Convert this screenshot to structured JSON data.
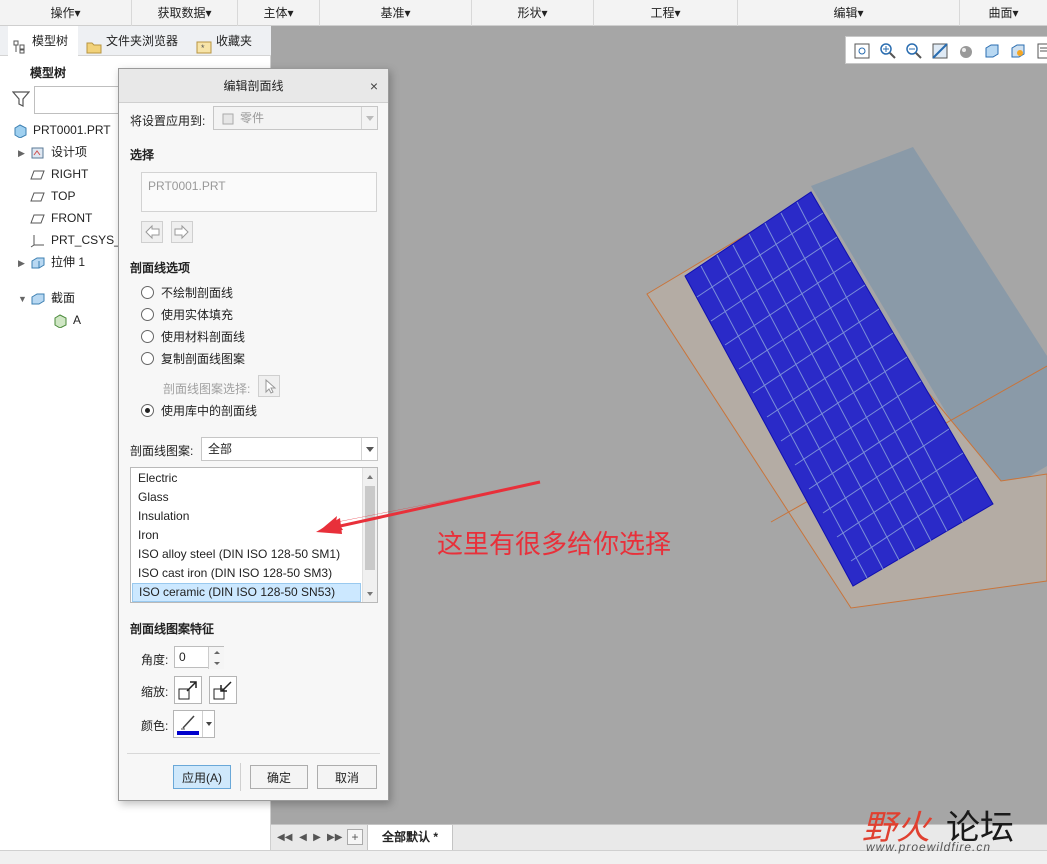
{
  "ribbon": {
    "groups": [
      "操作▾",
      "获取数据▾",
      "主体▾",
      "基准▾",
      "形状▾",
      "工程▾",
      "编辑▾",
      "曲面▾"
    ]
  },
  "left_panel": {
    "tabs": [
      "模型树",
      "文件夹浏览器",
      "收藏夹"
    ],
    "tree_title": "模型树",
    "filter_value": "",
    "items": [
      {
        "label": "PRT0001.PRT",
        "icon": "part-icon",
        "expand": ""
      },
      {
        "label": "设计项",
        "icon": "design-items-icon",
        "expand": "▶"
      },
      {
        "label": "RIGHT",
        "icon": "datum-plane-icon",
        "expand": ""
      },
      {
        "label": "TOP",
        "icon": "datum-plane-icon",
        "expand": ""
      },
      {
        "label": "FRONT",
        "icon": "datum-plane-icon",
        "expand": ""
      },
      {
        "label": "PRT_CSYS_DEF",
        "icon": "csys-icon",
        "expand": ""
      },
      {
        "label": "拉伸 1",
        "icon": "extrude-icon",
        "expand": "▶"
      },
      {
        "label": "截面",
        "icon": "section-icon",
        "expand": "▼"
      },
      {
        "label": "A",
        "icon": "section-a-icon",
        "expand": ""
      }
    ]
  },
  "dialog": {
    "title": "编辑剖面线",
    "close": "×",
    "apply_to_label": "将设置应用到:",
    "apply_to_value": "零件",
    "select_label": "选择",
    "selection_value": "PRT0001.PRT",
    "options_label": "剖面线选项",
    "radios": [
      {
        "label": "不绘制剖面线",
        "checked": false
      },
      {
        "label": "使用实体填充",
        "checked": false
      },
      {
        "label": "使用材料剖面线",
        "checked": false
      },
      {
        "label": "复制剖面线图案",
        "checked": false
      },
      {
        "label": "使用库中的剖面线",
        "checked": true
      }
    ],
    "pattern_pick_label": "剖面线图案选择:",
    "pattern_label": "剖面线图案:",
    "pattern_value": "全部",
    "patterns": [
      "Electric",
      "Glass",
      "Insulation",
      "Iron",
      "ISO alloy steel (DIN ISO 128-50 SM1)",
      "ISO cast iron (DIN ISO 128-50 SM3)",
      "ISO ceramic (DIN ISO 128-50 SN53)"
    ],
    "selected_pattern_index": 6,
    "features_label": "剖面线图案特征",
    "angle_label": "角度:",
    "angle_value": "0",
    "scale_label": "缩放:",
    "color_label": "颜色:",
    "hatch_color": "#0000cc",
    "buttons": {
      "apply": "应用(A)",
      "ok": "确定",
      "cancel": "取消"
    }
  },
  "bottom_bar": {
    "view_tab": "全部默认 *"
  },
  "annotation": {
    "text": "这里有很多给你选择",
    "color": "#e8303a"
  },
  "watermark": {
    "logo_part1": "野火",
    "logo_part2": "论坛",
    "url": "www.proewildfire.cn"
  }
}
